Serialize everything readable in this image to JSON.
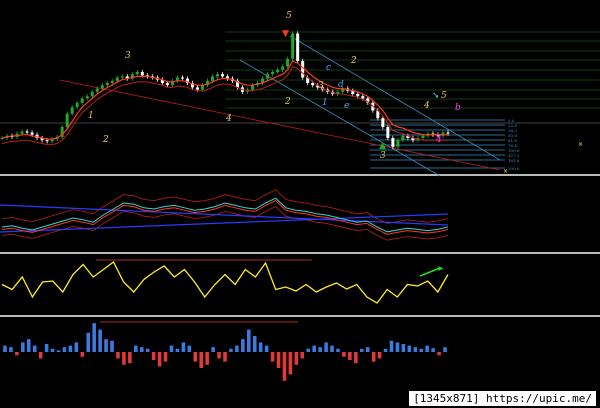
{
  "watermark": "[1345x871] https://upic.me/",
  "colors": {
    "background": "#000000",
    "separator": "#b9b9b9",
    "candle_up": "#22aa22",
    "candle_down": "#ffffff",
    "ma_fast": "#ff3a1a",
    "ma_slow": "#b8201a",
    "fib": "#33aa33",
    "channel": "#3a90c0",
    "wave_label": "#e8c95a",
    "wave_label_alt": "#4aa6ff",
    "wave_label_magenta": "#ff3aff",
    "cyan": "#3ad6d6",
    "yellow": "#ffee22",
    "hist_pos": "#3a7be0",
    "hist_neg": "#e03a3a"
  },
  "wave_labels": [
    "1",
    "2",
    "3",
    "4",
    "5",
    "2",
    "3",
    "4",
    "5",
    "b",
    "c",
    "d",
    "e",
    "1",
    "2",
    "3",
    "4"
  ],
  "fib_labels": [
    "0.0",
    "23.6",
    "38.2",
    "50.0",
    "61.8",
    "76.4",
    "100.0",
    "127.2",
    "161.8",
    "200.0"
  ],
  "chart_data": [
    {
      "type": "line",
      "title": "",
      "x_count": 120,
      "series": [
        {
          "values": [
            1.3,
            1.32,
            1.31,
            1.34,
            1.36,
            1.35,
            1.33,
            1.3,
            1.28,
            1.27,
            1.29,
            1.31,
            1.4,
            1.52,
            1.58,
            1.62,
            1.66,
            1.68,
            1.72,
            1.75,
            1.78,
            1.8,
            1.82,
            1.85,
            1.86,
            1.84,
            1.88,
            1.9,
            1.87,
            1.86,
            1.85,
            1.83,
            1.8,
            1.78,
            1.82,
            1.85,
            1.84,
            1.8,
            1.76,
            1.74,
            1.78,
            1.82,
            1.86,
            1.88,
            1.86,
            1.84,
            1.82,
            1.76,
            1.72,
            1.74,
            1.78,
            1.8,
            1.84,
            1.88,
            1.9,
            1.92,
            1.95,
            2.02,
            2.25,
            2.0,
            1.85,
            1.8,
            1.78,
            1.76,
            1.74,
            1.72,
            1.7,
            1.72,
            1.75,
            1.73,
            1.7,
            1.68,
            1.66,
            1.62,
            1.55,
            1.48,
            1.4,
            1.3,
            1.22,
            1.28,
            1.32,
            1.3,
            1.28,
            1.3,
            1.32,
            1.34,
            1.33,
            1.32,
            1.35,
            1.34
          ]
        },
        {
          "values": [
            1.3,
            1.31,
            1.32,
            1.32,
            1.33,
            1.33,
            1.32,
            1.31,
            1.3,
            1.29,
            1.29,
            1.3,
            1.33,
            1.38,
            1.45,
            1.52,
            1.58,
            1.62,
            1.66,
            1.7,
            1.73,
            1.76,
            1.78,
            1.81,
            1.83,
            1.84,
            1.85,
            1.86,
            1.86,
            1.86,
            1.85,
            1.84,
            1.83,
            1.81,
            1.81,
            1.82,
            1.82,
            1.81,
            1.79,
            1.78,
            1.78,
            1.79,
            1.81,
            1.83,
            1.84,
            1.84,
            1.83,
            1.81,
            1.79,
            1.78,
            1.78,
            1.79,
            1.8,
            1.82,
            1.84,
            1.86,
            1.88,
            1.92,
            2.0,
            1.98,
            1.94,
            1.9,
            1.86,
            1.83,
            1.8,
            1.78,
            1.76,
            1.75,
            1.75,
            1.74,
            1.73,
            1.72,
            1.7,
            1.68,
            1.64,
            1.6,
            1.55,
            1.48,
            1.42,
            1.4,
            1.39,
            1.37,
            1.35,
            1.34,
            1.33,
            1.33,
            1.33,
            1.33,
            1.33,
            1.33
          ]
        }
      ]
    },
    {
      "type": "line",
      "title": "",
      "series": [
        {
          "values": [
            0.3,
            0.32,
            0.28,
            0.25,
            0.3,
            0.35,
            0.4,
            0.45,
            0.42,
            0.38,
            0.5,
            0.6,
            0.7,
            0.68,
            0.62,
            0.6,
            0.64,
            0.66,
            0.62,
            0.58,
            0.6,
            0.64,
            0.7,
            0.66,
            0.62,
            0.6,
            0.7,
            0.78,
            0.62,
            0.58,
            0.56,
            0.52,
            0.5,
            0.46,
            0.42,
            0.38,
            0.4,
            0.3,
            0.22,
            0.25,
            0.28,
            0.26,
            0.24,
            0.26,
            0.3
          ]
        }
      ]
    },
    {
      "type": "line",
      "title": "",
      "series": [
        {
          "values": [
            0.55,
            0.45,
            0.7,
            0.3,
            0.6,
            0.62,
            0.4,
            0.75,
            0.95,
            0.7,
            0.85,
            1.0,
            0.6,
            0.4,
            0.65,
            0.8,
            0.92,
            0.7,
            0.85,
            0.6,
            0.3,
            0.55,
            0.75,
            0.55,
            0.85,
            0.7,
            0.98,
            0.45,
            0.5,
            0.42,
            0.55,
            0.4,
            0.5,
            0.58,
            0.46,
            0.55,
            0.3,
            0.18,
            0.45,
            0.3,
            0.55,
            0.52,
            0.62,
            0.4,
            0.75
          ]
        }
      ]
    },
    {
      "type": "bar",
      "title": "",
      "values": [
        0.2,
        0.15,
        -0.1,
        0.3,
        0.4,
        0.2,
        -0.2,
        0.25,
        0.1,
        0.05,
        0.15,
        0.2,
        0.3,
        -0.15,
        0.6,
        0.9,
        0.7,
        0.4,
        0.35,
        -0.2,
        -0.4,
        -0.35,
        0.2,
        0.15,
        0.1,
        -0.25,
        -0.45,
        -0.3,
        0.2,
        0.1,
        0.3,
        0.2,
        -0.3,
        -0.5,
        -0.4,
        0.15,
        -0.2,
        -0.3,
        0.1,
        0.2,
        0.4,
        0.7,
        0.5,
        0.3,
        0.2,
        -0.3,
        -0.5,
        -0.9,
        -0.7,
        -0.4,
        -0.2,
        0.1,
        0.2,
        0.15,
        0.3,
        0.2,
        0.1,
        -0.15,
        -0.25,
        -0.35,
        0.1,
        0.15,
        -0.3,
        -0.2,
        0.1,
        0.35,
        0.3,
        0.25,
        0.2,
        0.15,
        0.1,
        0.2,
        0.12,
        -0.1,
        0.15
      ]
    }
  ]
}
